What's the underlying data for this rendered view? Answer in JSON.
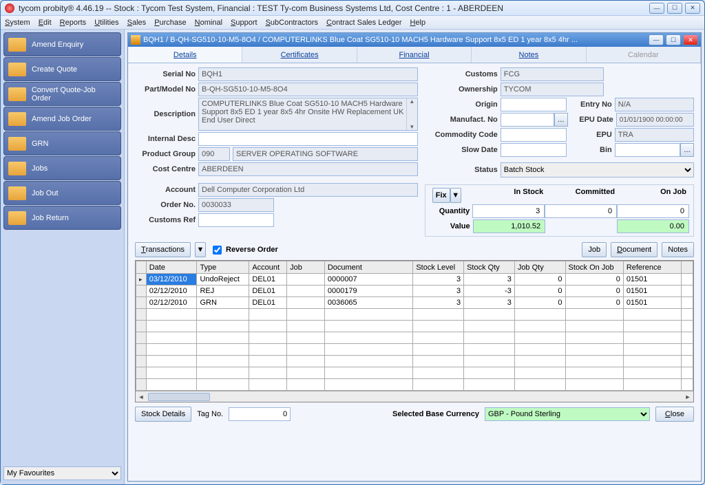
{
  "window": {
    "title": "tycom probity®  4.46.19 -- Stock : Tycom Test System, Financial : TEST Ty-com Business Systems Ltd, Cost Centre : 1 - ABERDEEN"
  },
  "menu": [
    "System",
    "Edit",
    "Reports",
    "Utilities",
    "Sales",
    "Purchase",
    "Nominal",
    "Support",
    "SubContractors",
    "Contract Sales Ledger",
    "Help"
  ],
  "sidebar": {
    "items": [
      {
        "label": "Amend Enquiry"
      },
      {
        "label": "Create Quote"
      },
      {
        "label": "Convert Quote-Job Order"
      },
      {
        "label": "Amend Job Order"
      },
      {
        "label": "GRN"
      },
      {
        "label": "Jobs"
      },
      {
        "label": "Job Out"
      },
      {
        "label": "Job Return"
      }
    ],
    "favourites": "My Favourites"
  },
  "inner": {
    "title": "BQH1 / B-QH-SG510-10-M5-8O4 / COMPUTERLINKS Blue Coat SG510-10 MACH5 Hardware Support 8x5 ED 1 year 8x5 4hr ...",
    "tabs": {
      "details": "Details",
      "certificates": "Certificates",
      "financial": "Financial",
      "notes": "Notes",
      "calendar": "Calendar"
    }
  },
  "form": {
    "serial_no_lbl": "Serial No",
    "serial_no": "BQH1",
    "part_lbl": "Part/Model No",
    "part": "B-QH-SG510-10-M5-8O4",
    "desc_lbl": "Description",
    "desc": "COMPUTERLINKS Blue Coat SG510-10 MACH5 Hardware Support 8x5 ED 1 year 8x5 4hr Onsite HW Replacement UK End User Direct",
    "intdesc_lbl": "Internal Desc",
    "pg_lbl": "Product Group",
    "pg_code": "090",
    "pg_name": "SERVER OPERATING SOFTWARE",
    "cc_lbl": "Cost Centre",
    "cc": "ABERDEEN",
    "acct_lbl": "Account",
    "acct": "Dell Computer Corporation Ltd",
    "order_lbl": "Order No.",
    "order": "0030033",
    "custref_lbl": "Customs Ref",
    "customs_lbl": "Customs",
    "customs": "FCG",
    "own_lbl": "Ownership",
    "own": "TYCOM",
    "origin_lbl": "Origin",
    "manuf_lbl": "Manufact. No",
    "comm_lbl": "Commodity Code",
    "slow_lbl": "Slow Date",
    "entry_lbl": "Entry No",
    "entry": "N/A",
    "epud_lbl": "EPU Date",
    "epud": "01/01/1900 00:00:00",
    "epu_lbl": "EPU",
    "epu": "TRA",
    "bin_lbl": "Bin",
    "status_lbl": "Status",
    "status": "Batch Stock",
    "fix": "Fix",
    "instock": "In Stock",
    "committed": "Committed",
    "onjob": "On Job",
    "qty_lbl": "Quantity",
    "q_in": "3",
    "q_comm": "0",
    "q_job": "0",
    "val_lbl": "Value",
    "v_in": "1,010.52",
    "v_job": "0.00"
  },
  "trans": {
    "label": "Transactions",
    "reverse": "Reverse Order",
    "job_btn": "Job",
    "doc_btn": "Document",
    "notes_btn": "Notes",
    "headers": [
      "Date",
      "Type",
      "Account",
      "Job",
      "Document",
      "Stock Level",
      "Stock Qty",
      "Job Qty",
      "Stock On Job",
      "Reference"
    ],
    "rows": [
      {
        "date": "03/12/2010",
        "type": "UndoReject",
        "acct": "DEL01",
        "job": "",
        "doc": "0000007",
        "sl": "3",
        "sq": "3",
        "jq": "0",
        "soj": "0",
        "ref": "01501",
        "sel": true
      },
      {
        "date": "02/12/2010",
        "type": "REJ",
        "acct": "DEL01",
        "job": "",
        "doc": "0000179",
        "sl": "3",
        "sq": "-3",
        "jq": "0",
        "soj": "0",
        "ref": "01501"
      },
      {
        "date": "02/12/2010",
        "type": "GRN",
        "acct": "DEL01",
        "job": "",
        "doc": "0036065",
        "sl": "3",
        "sq": "3",
        "jq": "0",
        "soj": "0",
        "ref": "01501"
      }
    ]
  },
  "bottom": {
    "stock_details": "Stock Details",
    "tag": "Tag No.",
    "tag_val": "0",
    "currency_lbl": "Selected Base Currency",
    "currency": "GBP - Pound Sterling",
    "close": "Close"
  }
}
